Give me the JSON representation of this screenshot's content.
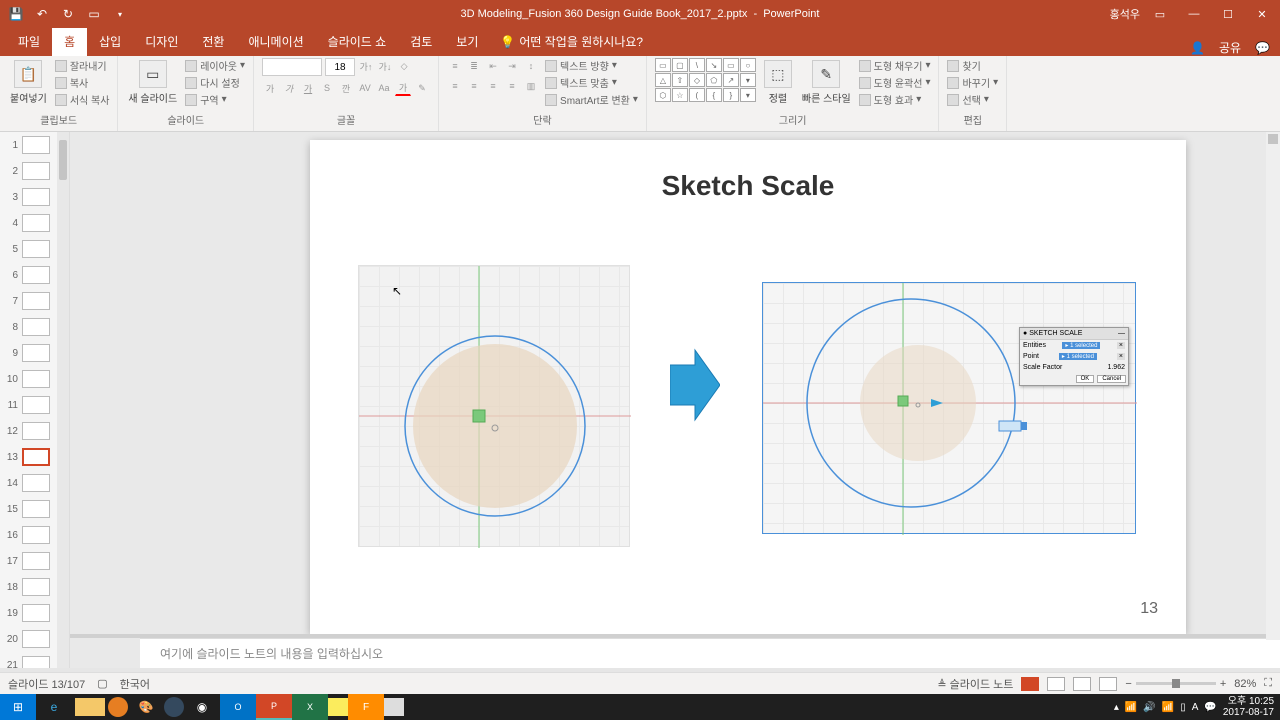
{
  "titlebar": {
    "filename": "3D Modeling_Fusion 360 Design Guide Book_2017_2.pptx",
    "appname": "PowerPoint",
    "username": "홍석우"
  },
  "tabs": {
    "file": "파일",
    "home": "홈",
    "insert": "삽입",
    "design": "디자인",
    "transitions": "전환",
    "animations": "애니메이션",
    "slideshow": "슬라이드 쇼",
    "review": "검토",
    "view": "보기",
    "tellme": "어떤 작업을 원하시나요?",
    "share": "공유"
  },
  "ribbon": {
    "clipboard": {
      "label": "클립보드",
      "paste": "붙여넣기",
      "cut": "잘라내기",
      "copy": "복사",
      "format": "서식 복사"
    },
    "slides": {
      "label": "슬라이드",
      "new": "새 슬라이드",
      "layout": "레이아웃",
      "reset": "다시 설정",
      "section": "구역"
    },
    "font": {
      "label": "글꼴",
      "size": "18"
    },
    "paragraph": {
      "label": "단락",
      "textdir": "텍스트 방향",
      "align": "텍스트 맞춤",
      "smartart": "SmartArt로 변환"
    },
    "drawing": {
      "label": "그리기",
      "arrange": "정렬",
      "quickstyle": "빠른 스타일",
      "fill": "도형 채우기",
      "outline": "도형 윤곽선",
      "effects": "도형 효과"
    },
    "editing": {
      "label": "편집",
      "find": "찾기",
      "replace": "바꾸기",
      "select": "선택"
    }
  },
  "slide": {
    "title": "Sketch Scale",
    "page_number": "13",
    "notes_placeholder": "여기에 슬라이드 노트의 내용을 입력하십시오"
  },
  "dialog": {
    "title": "SKETCH SCALE",
    "entities_label": "Entities",
    "entities_val": "1 selected",
    "point_label": "Point",
    "point_val": "1 selected",
    "scale_label": "Scale Factor",
    "scale_val": "1.962",
    "ok": "OK",
    "cancel": "Cancel"
  },
  "thumbs": {
    "count": 21,
    "selected": 13
  },
  "status": {
    "slide_pos": "슬라이드 13/107",
    "language": "한국어",
    "notes": "슬라이드 노트",
    "zoom": "82%"
  },
  "systray": {
    "time": "오후 10:25",
    "date": "2017-08-17"
  }
}
